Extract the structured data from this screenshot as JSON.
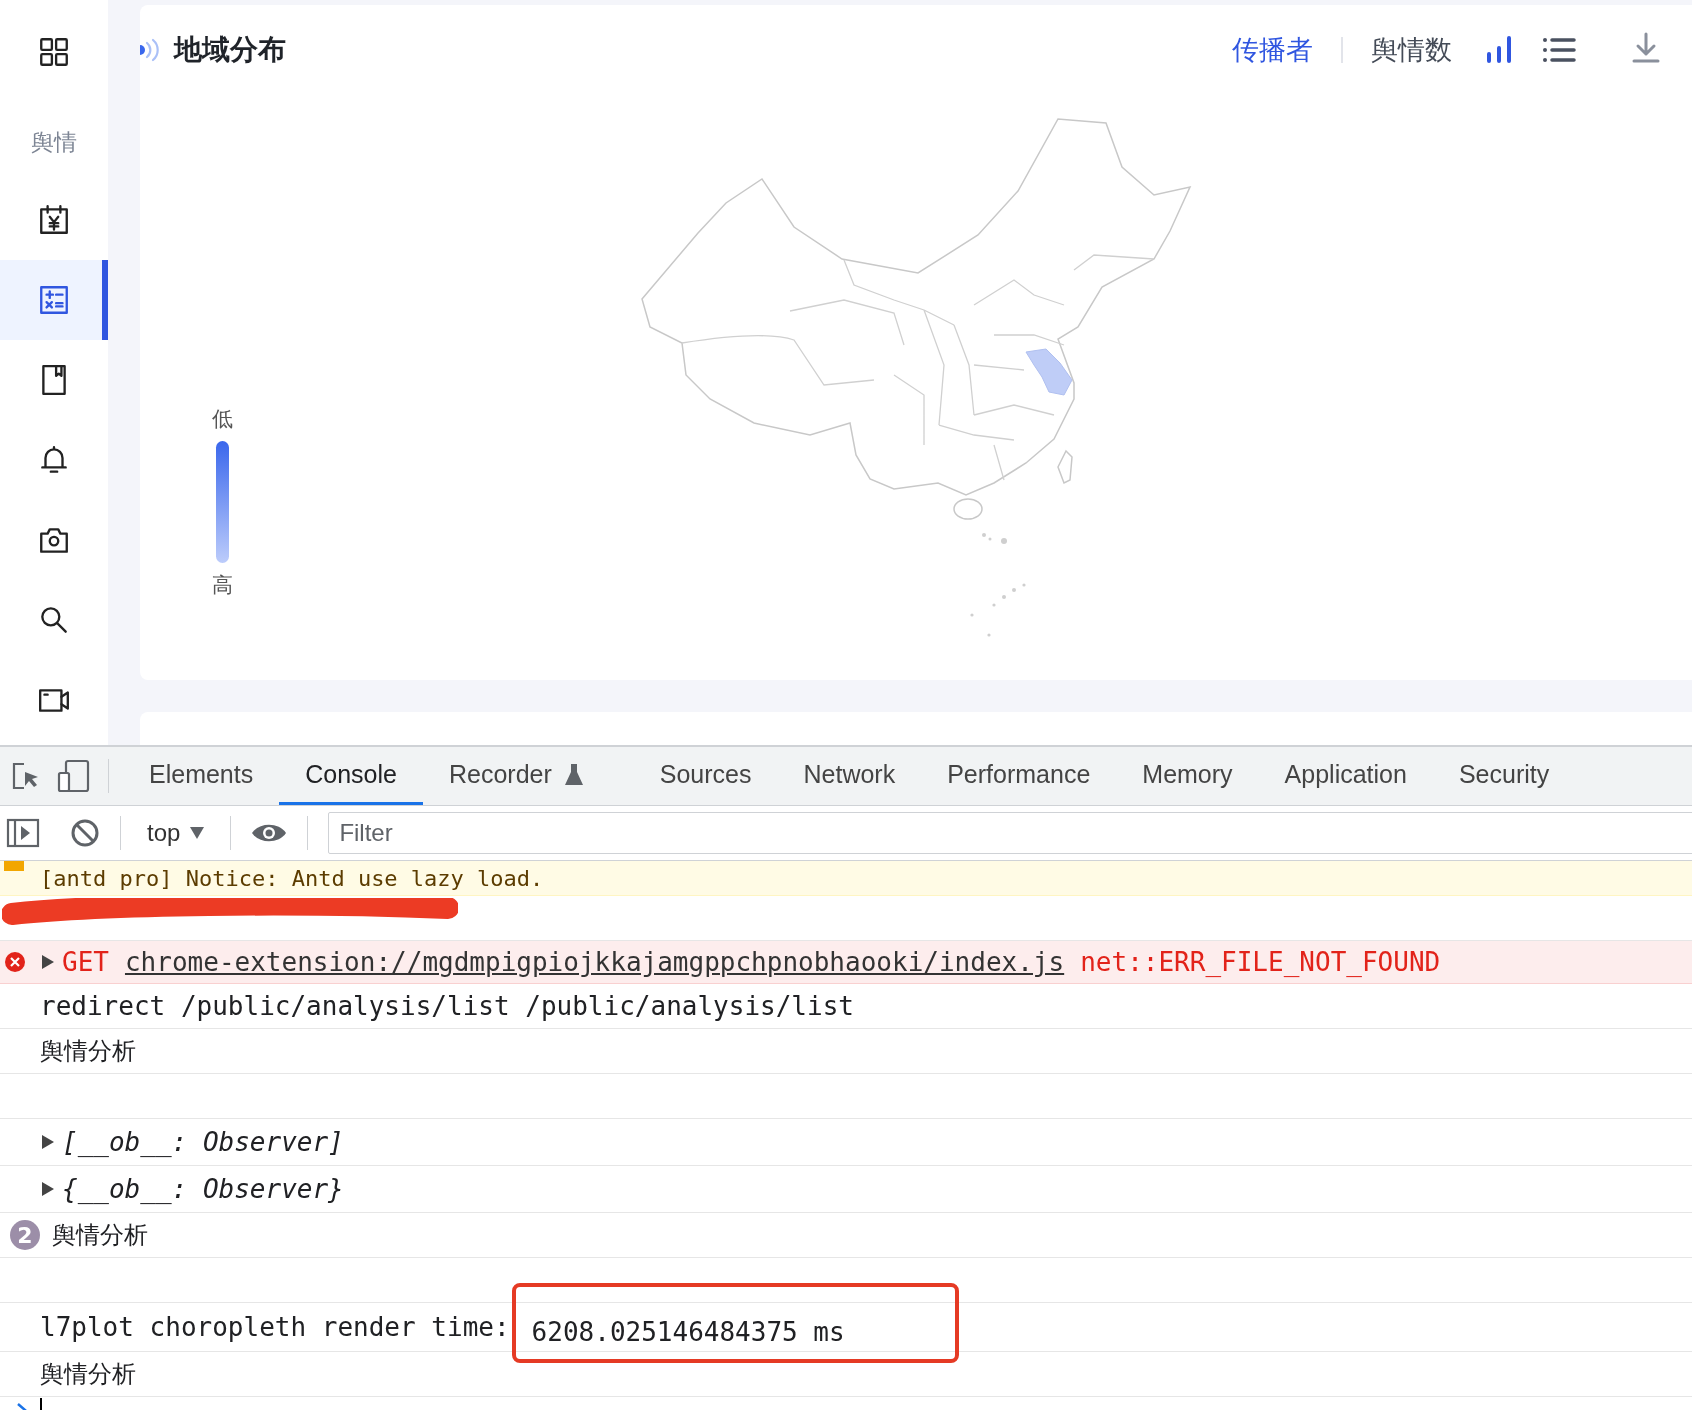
{
  "sidebar": {
    "label": "舆情",
    "items": [
      {
        "selected": false
      },
      {
        "selected": true
      },
      {
        "selected": false
      },
      {
        "selected": false
      },
      {
        "selected": false
      },
      {
        "selected": false
      },
      {
        "selected": false
      }
    ]
  },
  "panel": {
    "title": "地域分布",
    "toggle": [
      {
        "label": "传播者",
        "selected": true
      },
      {
        "label": "舆情数",
        "selected": false
      }
    ],
    "view_modes": [
      {
        "selected": true
      },
      {
        "selected": false
      }
    ],
    "legend": {
      "top": "低",
      "bottom": "高"
    }
  },
  "devtools": {
    "tabs": [
      {
        "label": "Elements",
        "selected": false
      },
      {
        "label": "Console",
        "selected": true
      },
      {
        "label": "Recorder",
        "selected": false
      },
      {
        "label": "Sources",
        "selected": false
      },
      {
        "label": "Network",
        "selected": false
      },
      {
        "label": "Performance",
        "selected": false
      },
      {
        "label": "Memory",
        "selected": false
      },
      {
        "label": "Application",
        "selected": false
      },
      {
        "label": "Security",
        "selected": false
      }
    ],
    "context": "top",
    "filter": {
      "placeholder": "Filter"
    },
    "messages": [
      {
        "kind": "warning",
        "text": "[antd pro] Notice: Antd use lazy load."
      },
      {
        "kind": "redacted"
      },
      {
        "kind": "error",
        "method": "GET",
        "url": "chrome-extension://mgdmpigpiojkkajamgppchpnobhaooki/index.js",
        "error": "net::ERR_FILE_NOT_FOUND"
      },
      {
        "kind": "log",
        "text": "redirect /public/analysis/list /public/analysis/list"
      },
      {
        "kind": "log",
        "text": "舆情分析"
      },
      {
        "kind": "blank"
      },
      {
        "kind": "object",
        "text": "[__ob__: Observer]"
      },
      {
        "kind": "object",
        "text": "{__ob__: Observer}"
      },
      {
        "kind": "repeat",
        "count": "2",
        "text": "舆情分析"
      },
      {
        "kind": "blank"
      },
      {
        "kind": "timing",
        "text": "l7plot choropleth render time:",
        "value": "6208.025146484375 ms"
      },
      {
        "kind": "log",
        "text": "舆情分析"
      }
    ]
  }
}
